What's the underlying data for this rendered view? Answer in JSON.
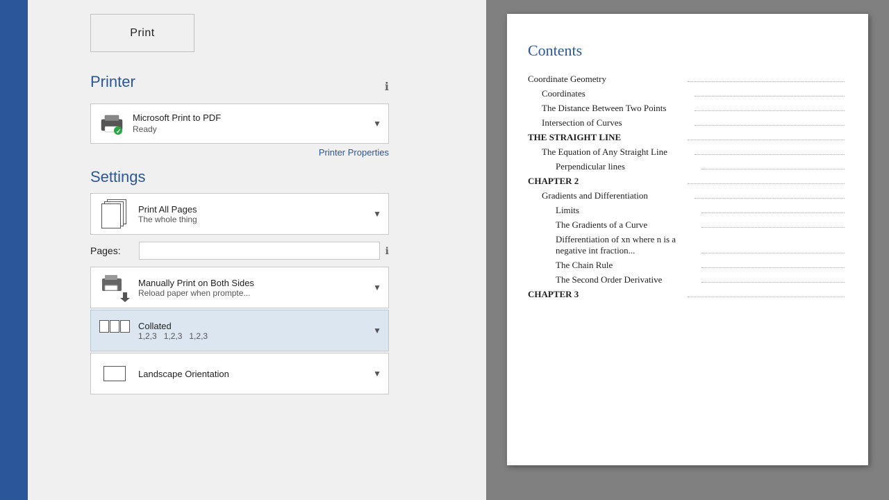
{
  "sidebar": {},
  "print_panel": {
    "print_button_label": "Print",
    "sections": {
      "printer": {
        "label": "Printer",
        "info_icon": "ℹ",
        "selected_printer": "Microsoft Print to PDF",
        "printer_status": "Ready",
        "printer_properties_link": "Printer Properties"
      },
      "settings": {
        "label": "Settings",
        "dropdowns": [
          {
            "id": "print-range",
            "main_label": "Print All Pages",
            "sub_label": "The whole thing",
            "has_arrow": true
          },
          {
            "id": "pages",
            "label_text": "Pages:",
            "input_value": "",
            "info_icon": "ℹ"
          },
          {
            "id": "duplex",
            "main_label": "Manually Print on Both Sides",
            "sub_label": "Reload paper when prompte...",
            "has_arrow": true
          },
          {
            "id": "collated",
            "main_label": "Collated",
            "sub_label": "1,2,3   1,2,3   1,2,3",
            "has_arrow": true,
            "highlighted": true
          },
          {
            "id": "orientation",
            "main_label": "Landscape Orientation",
            "has_arrow": true
          }
        ]
      }
    }
  },
  "preview": {
    "contents_title": "Contents",
    "toc_entries": [
      {
        "label": "Coordinate Geometry",
        "indent": 0,
        "bold": false
      },
      {
        "label": "Coordinates",
        "indent": 1,
        "bold": false
      },
      {
        "label": "The Distance Between Two Points",
        "indent": 1,
        "bold": false
      },
      {
        "label": "Intersection of Curves",
        "indent": 1,
        "bold": false
      },
      {
        "label": "THE STRAIGHT LINE",
        "indent": 0,
        "bold": true
      },
      {
        "label": "The Equation of Any Straight Line",
        "indent": 1,
        "bold": false
      },
      {
        "label": "Perpendicular lines",
        "indent": 2,
        "bold": false
      },
      {
        "label": "CHAPTER 2",
        "indent": 0,
        "bold": true
      },
      {
        "label": "Gradients and Differentiation",
        "indent": 1,
        "bold": false
      },
      {
        "label": "Limits",
        "indent": 2,
        "bold": false
      },
      {
        "label": "The Gradients of a Curve",
        "indent": 2,
        "bold": false
      },
      {
        "label": "Differentiation of xn where n is a negative int fraction...",
        "indent": 2,
        "bold": false
      },
      {
        "label": "The Chain Rule",
        "indent": 2,
        "bold": false
      },
      {
        "label": "The Second Order Derivative",
        "indent": 2,
        "bold": false
      },
      {
        "label": "CHAPTER 3",
        "indent": 0,
        "bold": true
      }
    ]
  }
}
